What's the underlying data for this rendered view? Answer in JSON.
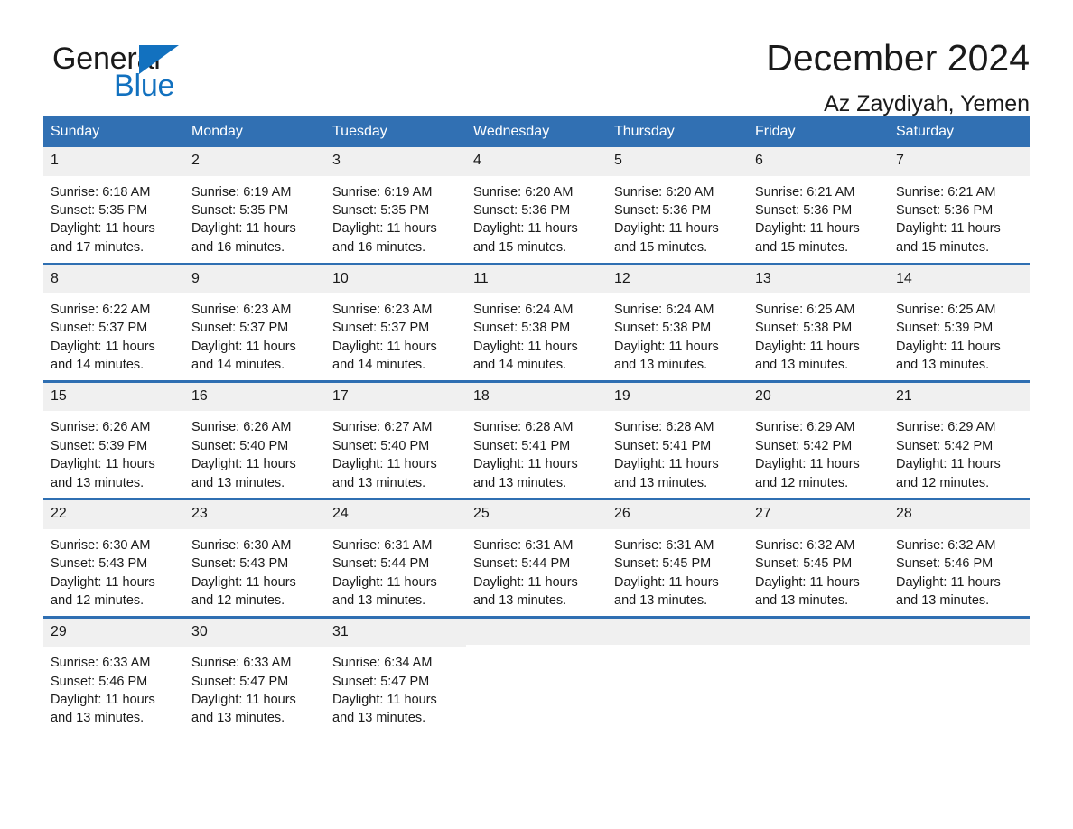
{
  "brand": {
    "name_part1": "General",
    "name_part2": "Blue",
    "triangle_icon": "triangle-icon",
    "accent_color": "#1271bf"
  },
  "header": {
    "month_title": "December 2024",
    "location": "Az Zaydiyah, Yemen"
  },
  "calendar": {
    "header_color": "#3170b3",
    "row_divider_color": "#2f6fb2",
    "day_number_band_color": "#f0f0f0",
    "weekdays": [
      "Sunday",
      "Monday",
      "Tuesday",
      "Wednesday",
      "Thursday",
      "Friday",
      "Saturday"
    ],
    "weeks": [
      [
        {
          "day": "1",
          "sunrise": "Sunrise: 6:18 AM",
          "sunset": "Sunset: 5:35 PM",
          "daylight": "Daylight: 11 hours and 17 minutes."
        },
        {
          "day": "2",
          "sunrise": "Sunrise: 6:19 AM",
          "sunset": "Sunset: 5:35 PM",
          "daylight": "Daylight: 11 hours and 16 minutes."
        },
        {
          "day": "3",
          "sunrise": "Sunrise: 6:19 AM",
          "sunset": "Sunset: 5:35 PM",
          "daylight": "Daylight: 11 hours and 16 minutes."
        },
        {
          "day": "4",
          "sunrise": "Sunrise: 6:20 AM",
          "sunset": "Sunset: 5:36 PM",
          "daylight": "Daylight: 11 hours and 15 minutes."
        },
        {
          "day": "5",
          "sunrise": "Sunrise: 6:20 AM",
          "sunset": "Sunset: 5:36 PM",
          "daylight": "Daylight: 11 hours and 15 minutes."
        },
        {
          "day": "6",
          "sunrise": "Sunrise: 6:21 AM",
          "sunset": "Sunset: 5:36 PM",
          "daylight": "Daylight: 11 hours and 15 minutes."
        },
        {
          "day": "7",
          "sunrise": "Sunrise: 6:21 AM",
          "sunset": "Sunset: 5:36 PM",
          "daylight": "Daylight: 11 hours and 15 minutes."
        }
      ],
      [
        {
          "day": "8",
          "sunrise": "Sunrise: 6:22 AM",
          "sunset": "Sunset: 5:37 PM",
          "daylight": "Daylight: 11 hours and 14 minutes."
        },
        {
          "day": "9",
          "sunrise": "Sunrise: 6:23 AM",
          "sunset": "Sunset: 5:37 PM",
          "daylight": "Daylight: 11 hours and 14 minutes."
        },
        {
          "day": "10",
          "sunrise": "Sunrise: 6:23 AM",
          "sunset": "Sunset: 5:37 PM",
          "daylight": "Daylight: 11 hours and 14 minutes."
        },
        {
          "day": "11",
          "sunrise": "Sunrise: 6:24 AM",
          "sunset": "Sunset: 5:38 PM",
          "daylight": "Daylight: 11 hours and 14 minutes."
        },
        {
          "day": "12",
          "sunrise": "Sunrise: 6:24 AM",
          "sunset": "Sunset: 5:38 PM",
          "daylight": "Daylight: 11 hours and 13 minutes."
        },
        {
          "day": "13",
          "sunrise": "Sunrise: 6:25 AM",
          "sunset": "Sunset: 5:38 PM",
          "daylight": "Daylight: 11 hours and 13 minutes."
        },
        {
          "day": "14",
          "sunrise": "Sunrise: 6:25 AM",
          "sunset": "Sunset: 5:39 PM",
          "daylight": "Daylight: 11 hours and 13 minutes."
        }
      ],
      [
        {
          "day": "15",
          "sunrise": "Sunrise: 6:26 AM",
          "sunset": "Sunset: 5:39 PM",
          "daylight": "Daylight: 11 hours and 13 minutes."
        },
        {
          "day": "16",
          "sunrise": "Sunrise: 6:26 AM",
          "sunset": "Sunset: 5:40 PM",
          "daylight": "Daylight: 11 hours and 13 minutes."
        },
        {
          "day": "17",
          "sunrise": "Sunrise: 6:27 AM",
          "sunset": "Sunset: 5:40 PM",
          "daylight": "Daylight: 11 hours and 13 minutes."
        },
        {
          "day": "18",
          "sunrise": "Sunrise: 6:28 AM",
          "sunset": "Sunset: 5:41 PM",
          "daylight": "Daylight: 11 hours and 13 minutes."
        },
        {
          "day": "19",
          "sunrise": "Sunrise: 6:28 AM",
          "sunset": "Sunset: 5:41 PM",
          "daylight": "Daylight: 11 hours and 13 minutes."
        },
        {
          "day": "20",
          "sunrise": "Sunrise: 6:29 AM",
          "sunset": "Sunset: 5:42 PM",
          "daylight": "Daylight: 11 hours and 12 minutes."
        },
        {
          "day": "21",
          "sunrise": "Sunrise: 6:29 AM",
          "sunset": "Sunset: 5:42 PM",
          "daylight": "Daylight: 11 hours and 12 minutes."
        }
      ],
      [
        {
          "day": "22",
          "sunrise": "Sunrise: 6:30 AM",
          "sunset": "Sunset: 5:43 PM",
          "daylight": "Daylight: 11 hours and 12 minutes."
        },
        {
          "day": "23",
          "sunrise": "Sunrise: 6:30 AM",
          "sunset": "Sunset: 5:43 PM",
          "daylight": "Daylight: 11 hours and 12 minutes."
        },
        {
          "day": "24",
          "sunrise": "Sunrise: 6:31 AM",
          "sunset": "Sunset: 5:44 PM",
          "daylight": "Daylight: 11 hours and 13 minutes."
        },
        {
          "day": "25",
          "sunrise": "Sunrise: 6:31 AM",
          "sunset": "Sunset: 5:44 PM",
          "daylight": "Daylight: 11 hours and 13 minutes."
        },
        {
          "day": "26",
          "sunrise": "Sunrise: 6:31 AM",
          "sunset": "Sunset: 5:45 PM",
          "daylight": "Daylight: 11 hours and 13 minutes."
        },
        {
          "day": "27",
          "sunrise": "Sunrise: 6:32 AM",
          "sunset": "Sunset: 5:45 PM",
          "daylight": "Daylight: 11 hours and 13 minutes."
        },
        {
          "day": "28",
          "sunrise": "Sunrise: 6:32 AM",
          "sunset": "Sunset: 5:46 PM",
          "daylight": "Daylight: 11 hours and 13 minutes."
        }
      ],
      [
        {
          "day": "29",
          "sunrise": "Sunrise: 6:33 AM",
          "sunset": "Sunset: 5:46 PM",
          "daylight": "Daylight: 11 hours and 13 minutes."
        },
        {
          "day": "30",
          "sunrise": "Sunrise: 6:33 AM",
          "sunset": "Sunset: 5:47 PM",
          "daylight": "Daylight: 11 hours and 13 minutes."
        },
        {
          "day": "31",
          "sunrise": "Sunrise: 6:34 AM",
          "sunset": "Sunset: 5:47 PM",
          "daylight": "Daylight: 11 hours and 13 minutes."
        },
        {
          "day": "",
          "sunrise": "",
          "sunset": "",
          "daylight": ""
        },
        {
          "day": "",
          "sunrise": "",
          "sunset": "",
          "daylight": ""
        },
        {
          "day": "",
          "sunrise": "",
          "sunset": "",
          "daylight": ""
        },
        {
          "day": "",
          "sunrise": "",
          "sunset": "",
          "daylight": ""
        }
      ]
    ]
  }
}
